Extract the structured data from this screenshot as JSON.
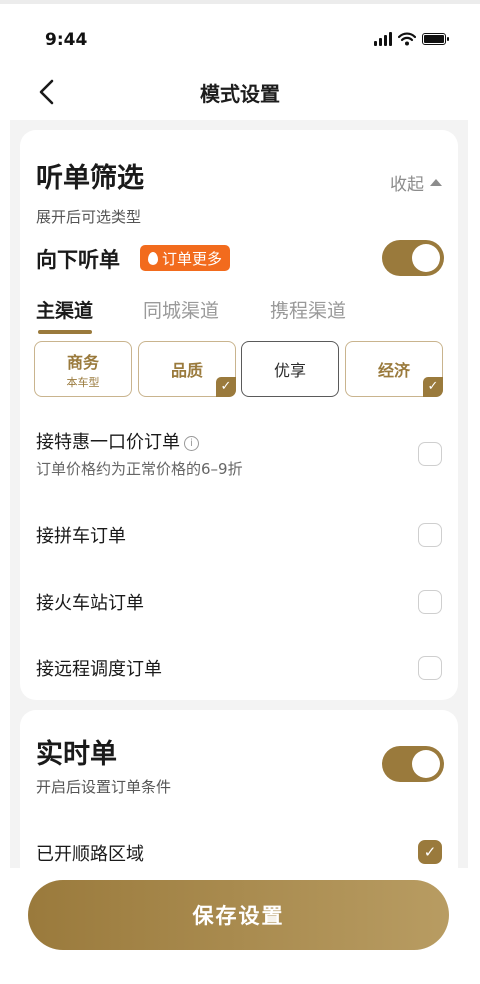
{
  "status_bar": {
    "time": "9:44"
  },
  "nav": {
    "title": "模式设置"
  },
  "filter_section": {
    "title": "听单筛选",
    "subtitle": "展开后可选类型",
    "collapse_label": "收起",
    "listen_down": {
      "label": "向下听单",
      "badge": "订单更多",
      "enabled": true
    },
    "tabs": [
      {
        "label": "主渠道",
        "active": true
      },
      {
        "label": "同城渠道",
        "active": false
      },
      {
        "label": "携程渠道",
        "active": false
      }
    ],
    "vehicle_types": [
      {
        "label": "商务",
        "sub": "本车型",
        "checked": false
      },
      {
        "label": "品质",
        "sub": "",
        "checked": true
      },
      {
        "label": "优享",
        "sub": "",
        "checked": false
      },
      {
        "label": "经济",
        "sub": "",
        "checked": true
      }
    ],
    "options": [
      {
        "label": "接特惠一口价订单",
        "desc": "订单价格约为正常价格的6–9折",
        "checked": false
      },
      {
        "label": "接拼车订单",
        "desc": "",
        "checked": false
      },
      {
        "label": "接火车站订单",
        "desc": "",
        "checked": false
      },
      {
        "label": "接远程调度订单",
        "desc": "",
        "checked": false
      }
    ]
  },
  "realtime_section": {
    "title": "实时单",
    "subtitle": "开启后设置订单条件",
    "enabled": true,
    "route_area": {
      "label": "已开顺路区域",
      "checked": true
    }
  },
  "save_button": {
    "label": "保存设置"
  },
  "colors": {
    "accent": "#9a7a3c",
    "badge": "#f26b1d",
    "background": "#f3f3f3"
  },
  "icons": {
    "info": "i",
    "check": "✓"
  }
}
